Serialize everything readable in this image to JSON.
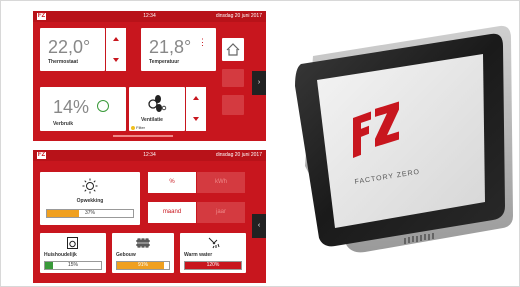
{
  "screen1": {
    "topbar": {
      "logo": "FZ",
      "time": "12:34",
      "date": "dinsdag 20 juni 2017"
    },
    "thermostaat": {
      "value": "22,0°",
      "label": "Thermostaat"
    },
    "temperatuur": {
      "value": "21,8°",
      "label": "Temperatuur"
    },
    "verbruik": {
      "value": "14%",
      "label": "Verbruik"
    },
    "ventilatie": {
      "label": "Ventilatie",
      "badge": "Filter"
    },
    "side_arrow": "›"
  },
  "screen2": {
    "topbar": {
      "logo": "FZ",
      "time": "12:34",
      "date": "dinsdag 20 juni 2017"
    },
    "opwekking": {
      "label": "Opwekking",
      "value": "37%",
      "fraction": 0.37
    },
    "unit_toggle": {
      "left": "%",
      "right": "kWh"
    },
    "period_toggle": {
      "left": "maand",
      "right": "jaar"
    },
    "huishoudelijk": {
      "label": "Huishoudelijk",
      "value": "15%",
      "fraction": 0.15,
      "color": "#3a9a3a"
    },
    "gebouw": {
      "label": "Gebouw",
      "value": "91%",
      "fraction": 0.91,
      "color": "#f0a020"
    },
    "warm_water": {
      "label": "Warm water",
      "value": "120%",
      "fraction": 1.0,
      "color": "#c8161e"
    },
    "side_arrow": "‹"
  },
  "device": {
    "brand": "FACTORY ZERO",
    "logo": "FZ"
  }
}
